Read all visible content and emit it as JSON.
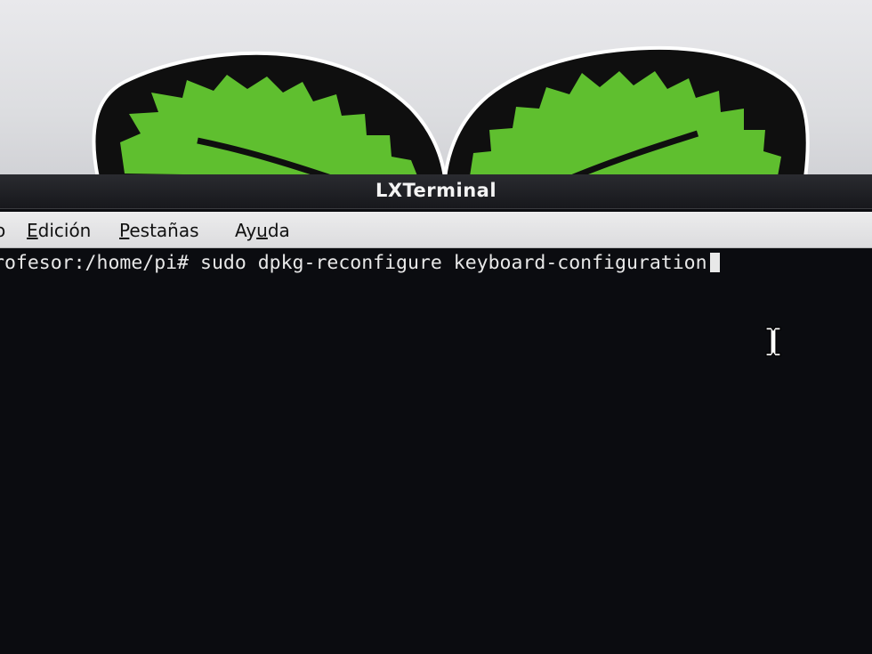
{
  "window": {
    "title": "LXTerminal"
  },
  "menu": {
    "items": [
      {
        "id": "archivo",
        "visible_text": "o",
        "underlined": "",
        "rest": "o"
      },
      {
        "id": "edicion",
        "underlined": "E",
        "rest": "dición"
      },
      {
        "id": "pestanas",
        "underlined": "P",
        "rest": "estañas"
      },
      {
        "id": "ayuda",
        "underlined": "",
        "prefix": "Ay",
        "underlined_mid": "u",
        "suffix": "da"
      }
    ]
  },
  "terminal": {
    "prompt": "rofesor:/home/pi#",
    "command": " sudo dpkg-reconfigure keyboard-configuration"
  },
  "colors": {
    "terminal_background": "#0b0c10",
    "terminal_text": "#e8e8e8",
    "title_bar": "#1c1d21",
    "menu_bar": "#e4e4e6",
    "leaf_green": "#5fbf2f",
    "leaf_outline": "#111111"
  },
  "icons": {
    "wallpaper": "raspberry-leaves-logo",
    "pointer": "i-beam-cursor-icon"
  }
}
